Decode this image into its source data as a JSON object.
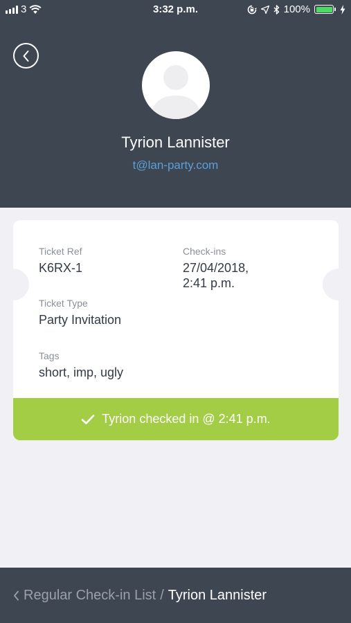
{
  "status_bar": {
    "carrier": "3",
    "time": "3:32 p.m.",
    "battery": "100%",
    "icons": [
      "signal-icon",
      "wifi-icon",
      "screen-lock-icon",
      "location-icon",
      "bluetooth-icon",
      "battery-icon",
      "charging-icon"
    ]
  },
  "profile": {
    "name": "Tyrion Lannister",
    "email": "t@lan-party.com"
  },
  "ticket": {
    "ref_label": "Ticket Ref",
    "ref_value": "K6RX-1",
    "checkins_label": "Check-ins",
    "checkins_value_line1": "27/04/2018,",
    "checkins_value_line2": "2:41 p.m.",
    "type_label": "Ticket Type",
    "type_value": "Party Invitation",
    "tags_label": "Tags",
    "tags_value": "short, imp, ugly"
  },
  "checkin_status": {
    "text": "Tyrion checked in @ 2:41 p.m.",
    "color": "#a2cd45"
  },
  "breadcrumb": {
    "parent": "Regular Check-in List",
    "separator": "/",
    "current": "Tyrion Lannister"
  },
  "colors": {
    "header_bg": "#3e4651",
    "email_link": "#5d9fd8",
    "page_bg": "#f1f1f5"
  }
}
